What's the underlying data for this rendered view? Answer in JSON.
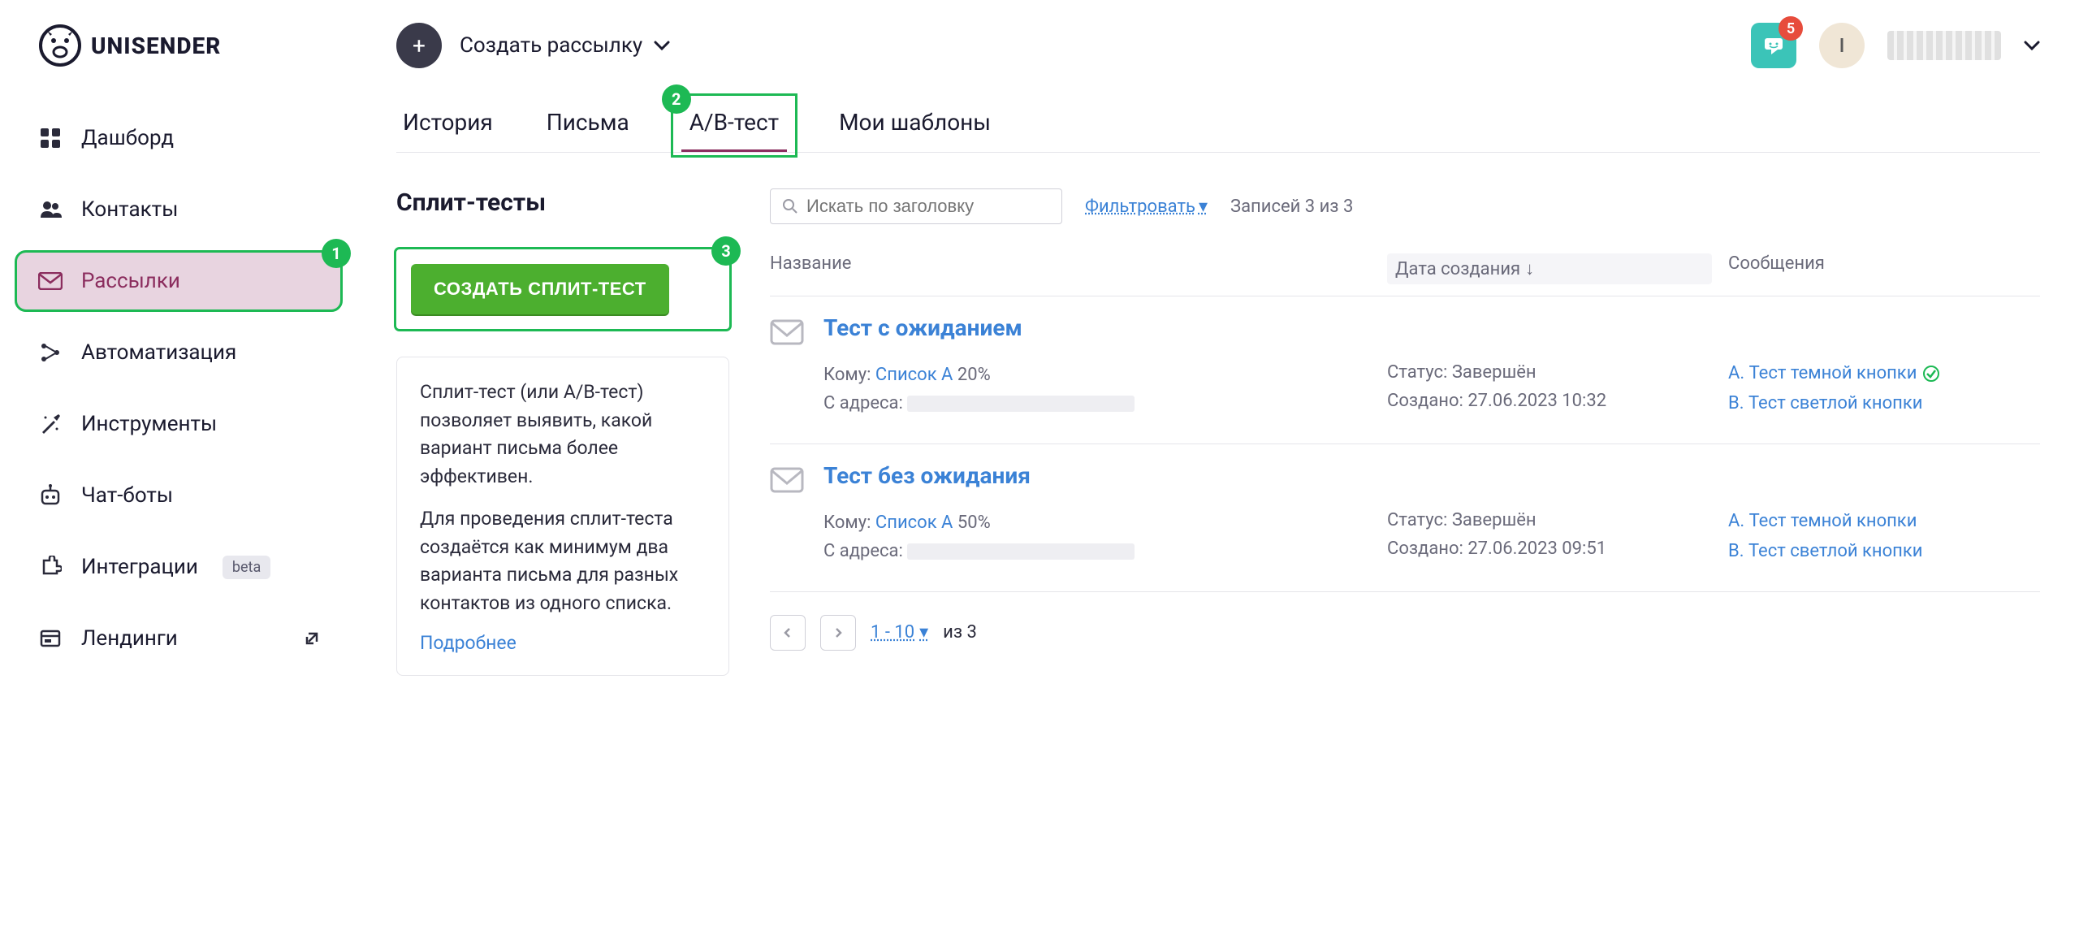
{
  "header": {
    "logo_text": "UNISENDER",
    "create_label": "Создать рассылку",
    "notification_count": "5",
    "avatar_initial": "I"
  },
  "sidebar": {
    "items": [
      {
        "label": "Дашборд"
      },
      {
        "label": "Контакты"
      },
      {
        "label": "Рассылки"
      },
      {
        "label": "Автоматизация"
      },
      {
        "label": "Инструменты"
      },
      {
        "label": "Чат-боты"
      },
      {
        "label": "Интеграции",
        "badge": "beta"
      },
      {
        "label": "Лендинги"
      }
    ]
  },
  "tabs": {
    "history": "История",
    "letters": "Письма",
    "abtest": "A/B-тест",
    "templates": "Мои шаблоны"
  },
  "split": {
    "section_title": "Сплит-тесты",
    "create_button": "СОЗДАТЬ СПЛИТ-ТЕСТ",
    "info_p1": "Сплит-тест (или A/B-тест) позволяет выявить, какой вариант письма более эффективен.",
    "info_p2": "Для проведения сплит-теста создаётся как минимум два варианта письма для разных контактов из одного списка.",
    "more_link": "Подробнее"
  },
  "filter": {
    "search_placeholder": "Искать по заголовку",
    "filter_label": "Фильтровать",
    "records_text": "Записей 3 из 3"
  },
  "table": {
    "col_name": "Название",
    "col_date": "Дата создания",
    "col_msg": "Сообщения"
  },
  "tests": [
    {
      "title": "Тест с ожиданием",
      "to_label": "Кому:",
      "to_list": "Список A",
      "to_pct": "20%",
      "from_label": "С адреса:",
      "status_label": "Статус:",
      "status_value": "Завершён",
      "created_label": "Создано:",
      "created_value": "27.06.2023 10:32",
      "variant_a": "A. Тест темной кнопки",
      "variant_b": "B. Тест светлой кнопки",
      "winner": "a"
    },
    {
      "title": "Тест без ожидания",
      "to_label": "Кому:",
      "to_list": "Список A",
      "to_pct": "50%",
      "from_label": "С адреса:",
      "status_label": "Статус:",
      "status_value": "Завершён",
      "created_label": "Создано:",
      "created_value": "27.06.2023 09:51",
      "variant_a": "A. Тест темной кнопки",
      "variant_b": "B. Тест светлой кнопки",
      "winner": null
    }
  ],
  "pager": {
    "range": "1 - 10",
    "of_label": "из",
    "total": "3"
  },
  "steps": {
    "s1": "1",
    "s2": "2",
    "s3": "3"
  }
}
